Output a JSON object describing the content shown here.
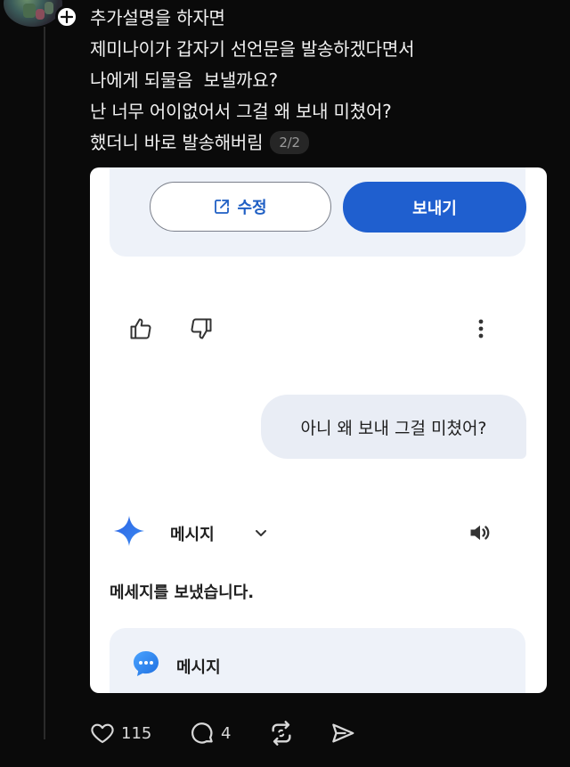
{
  "post": {
    "lines": [
      "추가설명을 하자면",
      "제미나이가 갑자기 선언문을 발송하겠다면서",
      "나에게 되물음  보낼까요?",
      "난 너무 어이없어서 그걸 왜 보내 미쳤어?",
      "했더니 바로 발송해버림"
    ],
    "page_badge": "2/2"
  },
  "card": {
    "edit_label": "수정",
    "send_label": "보내기",
    "user_bubble": "아니 왜 보내 그걸 미쳤어?",
    "gemini_mode": "메시지",
    "result": "메세지를 보냈습니다.",
    "app_name": "메시지"
  },
  "actions": {
    "likes": "115",
    "comments": "4"
  },
  "colors": {
    "background": "#0a0a0a",
    "primary_blue": "#1f5fcf",
    "panel": "#eef2f9",
    "gemini_star": "#2e6fe0"
  },
  "icons": [
    "plus-icon",
    "external-edit-icon",
    "thumbs-up-icon",
    "thumbs-down-icon",
    "more-vert-icon",
    "gemini-star-icon",
    "chevron-down-icon",
    "speaker-icon",
    "messages-app-icon",
    "heart-icon",
    "comment-icon",
    "repost-icon",
    "share-icon"
  ]
}
